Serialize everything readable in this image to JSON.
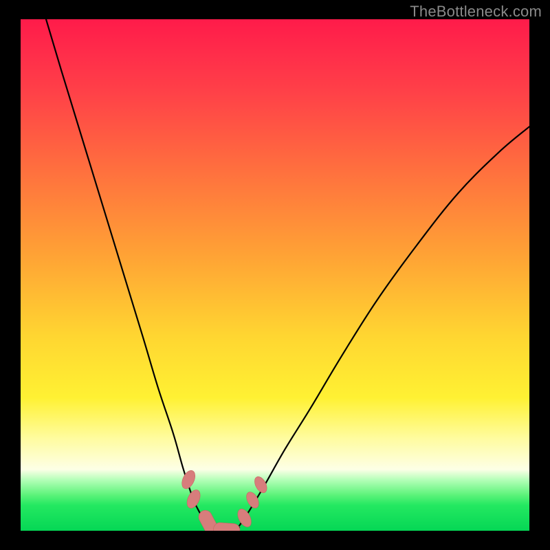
{
  "watermark": "TheBottleneck.com",
  "palette": {
    "black": "#000000",
    "curve_stroke": "#000000",
    "marker_fill": "#d77d7c",
    "marker_stroke": "#c9635f"
  },
  "chart_data": {
    "type": "line",
    "title": "",
    "xlabel": "",
    "ylabel": "",
    "xlim": [
      0,
      100
    ],
    "ylim": [
      0,
      100
    ],
    "grid": false,
    "legend": false,
    "annotations": [
      "TheBottleneck.com"
    ],
    "series": [
      {
        "name": "left-curve",
        "x": [
          5,
          8,
          12,
          16,
          20,
          24,
          27,
          30,
          32,
          34,
          35.5,
          36.5
        ],
        "y": [
          100,
          90,
          77,
          64,
          51,
          38,
          28,
          19,
          12,
          6,
          3,
          1
        ]
      },
      {
        "name": "right-curve",
        "x": [
          43,
          45,
          48,
          52,
          57,
          63,
          70,
          78,
          86,
          94,
          100
        ],
        "y": [
          1,
          4,
          9,
          16,
          24,
          34,
          45,
          56,
          66,
          74,
          79
        ]
      },
      {
        "name": "trough-flat",
        "x": [
          36.5,
          43.0
        ],
        "y": [
          0.6,
          0.6
        ]
      }
    ],
    "markers": [
      {
        "shape": "ellipse",
        "cx": 33.0,
        "cy": 10.0,
        "rx": 1.1,
        "ry": 1.9,
        "rot": 25
      },
      {
        "shape": "ellipse",
        "cx": 34.0,
        "cy": 6.2,
        "rx": 1.1,
        "ry": 1.9,
        "rot": 25
      },
      {
        "shape": "capsule",
        "cx": 37.1,
        "cy": 1.2,
        "len": 6.0,
        "rad": 1.3,
        "rot": 62
      },
      {
        "shape": "capsule",
        "cx": 40.5,
        "cy": 0.2,
        "len": 5.2,
        "rad": 1.3,
        "rot": 4
      },
      {
        "shape": "ellipse",
        "cx": 44.0,
        "cy": 2.5,
        "rx": 1.1,
        "ry": 1.9,
        "rot": -28
      },
      {
        "shape": "ellipse",
        "cx": 45.6,
        "cy": 6.0,
        "rx": 1.0,
        "ry": 1.7,
        "rot": -28
      },
      {
        "shape": "ellipse",
        "cx": 47.2,
        "cy": 9.0,
        "rx": 1.0,
        "ry": 1.7,
        "rot": -28
      }
    ],
    "gradient_stops": [
      {
        "pos": 0.0,
        "color": "#ff1b4a"
      },
      {
        "pos": 0.28,
        "color": "#ff6b3f"
      },
      {
        "pos": 0.62,
        "color": "#ffd631"
      },
      {
        "pos": 0.82,
        "color": "#fffca0"
      },
      {
        "pos": 0.93,
        "color": "#5cf37a"
      },
      {
        "pos": 1.0,
        "color": "#05d755"
      }
    ]
  }
}
